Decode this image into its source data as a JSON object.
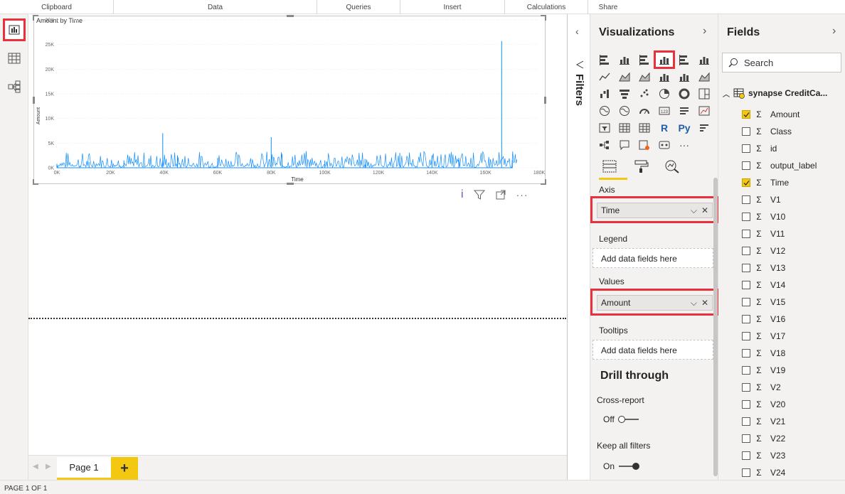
{
  "ribbon": {
    "groups": [
      {
        "label": "Clipboard"
      },
      {
        "label": "Data"
      },
      {
        "label": "Queries"
      },
      {
        "label": "Insert"
      },
      {
        "label": "Calculations"
      },
      {
        "label": "Share"
      }
    ]
  },
  "leftnav": {
    "items": [
      {
        "icon": "report-view-icon",
        "active": true
      },
      {
        "icon": "data-view-icon",
        "active": false
      },
      {
        "icon": "model-view-icon",
        "active": false
      }
    ]
  },
  "visual": {
    "title": "Amount by Time"
  },
  "chart_data": {
    "type": "line",
    "title": "Amount by Time",
    "xlabel": "Time",
    "ylabel": "Amount",
    "xlim": [
      0,
      180000
    ],
    "ylim": [
      0,
      30000
    ],
    "x_ticks": [
      "0K",
      "20K",
      "40K",
      "60K",
      "80K",
      "100K",
      "120K",
      "140K",
      "160K",
      "180K"
    ],
    "y_ticks": [
      "0K",
      "5K",
      "10K",
      "15K",
      "20K",
      "25K",
      "30K"
    ],
    "series": [
      {
        "color": "#118dff",
        "x": [
          0,
          12000,
          25000,
          39500,
          45000,
          60000,
          80000,
          84000,
          100000,
          115000,
          128000,
          140000,
          150000,
          166000,
          170000
        ],
        "y": [
          800,
          1200,
          1500,
          7000,
          2500,
          2000,
          6200,
          2800,
          1500,
          1800,
          3000,
          2500,
          2000,
          25700,
          1500
        ]
      }
    ]
  },
  "pages": {
    "current": "Page 1",
    "add_label": "+",
    "status": "PAGE 1 OF 1"
  },
  "filters": {
    "label": "Filters"
  },
  "visualizations": {
    "title": "Visualizations",
    "icons": [
      "stacked-bar-icon",
      "stacked-column-icon",
      "clustered-bar-icon",
      "clustered-column-icon",
      "100-bar-icon",
      "100-column-icon",
      "line-chart-icon",
      "area-chart-icon",
      "stacked-area-icon",
      "line-column-icon",
      "line-clustered-icon",
      "ribbon-chart-icon",
      "waterfall-icon",
      "funnel-icon",
      "scatter-icon",
      "pie-icon",
      "donut-icon",
      "treemap-icon",
      "map-icon",
      "filled-map-icon",
      "gauge-icon",
      "card-icon",
      "multirow-card-icon",
      "kpi-icon",
      "slicer-icon",
      "table-icon",
      "matrix-icon",
      "r-visual-icon",
      "python-visual-icon",
      "key-influencers-icon",
      "decomposition-tree-icon",
      "qa-icon",
      "smart-narrative-icon",
      "paginated-icon",
      "more-icon"
    ],
    "r_label": "R",
    "py_label": "Py",
    "more_label": "···",
    "axis_label": "Axis",
    "axis_field": "Time",
    "legend_label": "Legend",
    "legend_placeholder": "Add data fields here",
    "values_label": "Values",
    "values_field": "Amount",
    "tooltips_label": "Tooltips",
    "tooltips_placeholder": "Add data fields here",
    "drill_title": "Drill through",
    "cross_report_label": "Cross-report",
    "cross_report_value": "Off",
    "keep_filters_label": "Keep all filters",
    "keep_filters_value": "On"
  },
  "fields": {
    "title": "Fields",
    "search_placeholder": "Search",
    "table_name": "synapse CreditCa...",
    "items": [
      {
        "name": "Amount",
        "checked": true,
        "sigma": true
      },
      {
        "name": "Class",
        "checked": false,
        "sigma": true
      },
      {
        "name": "id",
        "checked": false,
        "sigma": true
      },
      {
        "name": "output_label",
        "checked": false,
        "sigma": true
      },
      {
        "name": "Time",
        "checked": true,
        "sigma": true
      },
      {
        "name": "V1",
        "checked": false,
        "sigma": true
      },
      {
        "name": "V10",
        "checked": false,
        "sigma": true
      },
      {
        "name": "V11",
        "checked": false,
        "sigma": true
      },
      {
        "name": "V12",
        "checked": false,
        "sigma": true
      },
      {
        "name": "V13",
        "checked": false,
        "sigma": true
      },
      {
        "name": "V14",
        "checked": false,
        "sigma": true
      },
      {
        "name": "V15",
        "checked": false,
        "sigma": true
      },
      {
        "name": "V16",
        "checked": false,
        "sigma": true
      },
      {
        "name": "V17",
        "checked": false,
        "sigma": true
      },
      {
        "name": "V18",
        "checked": false,
        "sigma": true
      },
      {
        "name": "V19",
        "checked": false,
        "sigma": true
      },
      {
        "name": "V2",
        "checked": false,
        "sigma": true
      },
      {
        "name": "V20",
        "checked": false,
        "sigma": true
      },
      {
        "name": "V21",
        "checked": false,
        "sigma": true
      },
      {
        "name": "V22",
        "checked": false,
        "sigma": true
      },
      {
        "name": "V23",
        "checked": false,
        "sigma": true
      },
      {
        "name": "V24",
        "checked": false,
        "sigma": true
      }
    ]
  },
  "colors": {
    "accent": "#f2c811",
    "highlight": "#e8313c",
    "series": "#118dff"
  }
}
